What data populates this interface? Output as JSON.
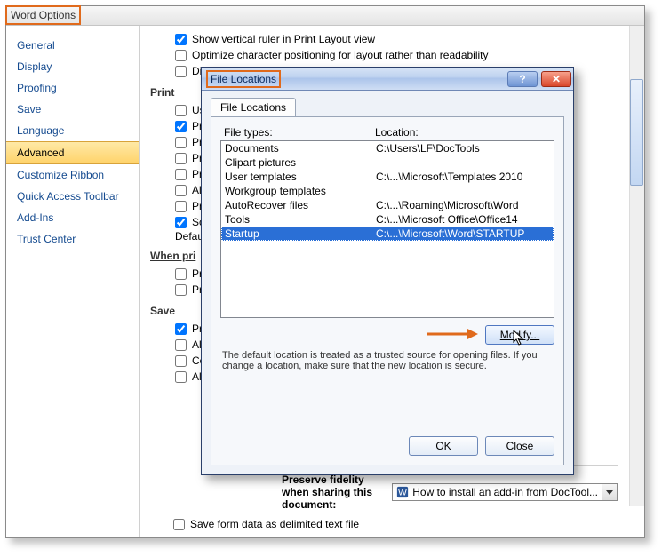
{
  "optionsWindow": {
    "title": "Word Options",
    "sidebar": {
      "items": [
        {
          "label": "General"
        },
        {
          "label": "Display"
        },
        {
          "label": "Proofing"
        },
        {
          "label": "Save"
        },
        {
          "label": "Language"
        },
        {
          "label": "Advanced",
          "active": true
        },
        {
          "label": "Customize Ribbon"
        },
        {
          "label": "Quick Access Toolbar"
        },
        {
          "label": "Add-Ins"
        },
        {
          "label": "Trust Center"
        }
      ]
    },
    "main": {
      "topChecks": [
        {
          "label": "Show vertical ruler in Print Layout view",
          "checked": true
        },
        {
          "label": "Optimize character positioning for layout rather than readability",
          "checked": false
        },
        {
          "label": "Disa",
          "checked": false
        }
      ],
      "printHead": "Print",
      "printChecks": [
        {
          "label": "Use",
          "checked": false
        },
        {
          "label": "Print",
          "checked": true
        },
        {
          "label": "Print",
          "checked": false
        },
        {
          "label": "Print",
          "checked": false
        },
        {
          "label": "Print",
          "checked": false
        },
        {
          "label": "Allow",
          "checked": false
        },
        {
          "label": "Print",
          "checked": false
        },
        {
          "label": "Scal",
          "checked": true
        }
      ],
      "defaultTray": "Default t",
      "whenHead": "When pri",
      "whenChecks": [
        {
          "label": "Print",
          "checked": false
        },
        {
          "label": "Print",
          "checked": false
        }
      ],
      "saveHead": "Save",
      "saveChecks": [
        {
          "label": "Pron",
          "checked": true
        },
        {
          "label": "Alwa",
          "checked": false
        },
        {
          "label": "Cop",
          "checked": false
        },
        {
          "label": "Allow",
          "checked": false
        }
      ],
      "preserve": {
        "label": "Preserve fidelity when sharing this document:",
        "value": "How to install an add-in from DocTool..."
      },
      "bottomCheck": {
        "label": "Save form data as delimited text file",
        "checked": false
      }
    }
  },
  "fileLocations": {
    "title": "File Locations",
    "tab": "File Locations",
    "col1": "File types:",
    "col2": "Location:",
    "rows": [
      {
        "type": "Documents",
        "loc": "C:\\Users\\LF\\DocTools"
      },
      {
        "type": "Clipart pictures",
        "loc": ""
      },
      {
        "type": "User templates",
        "loc": "C:\\...\\Microsoft\\Templates 2010"
      },
      {
        "type": "Workgroup templates",
        "loc": ""
      },
      {
        "type": "AutoRecover files",
        "loc": "C:\\...\\Roaming\\Microsoft\\Word"
      },
      {
        "type": "Tools",
        "loc": "C:\\...\\Microsoft Office\\Office14"
      },
      {
        "type": "Startup",
        "loc": "C:\\...\\Microsoft\\Word\\STARTUP",
        "selected": true
      }
    ],
    "modify": "Modify...",
    "note": "The default location is treated as a trusted source for opening files. If you change a location, make sure that the new location is secure.",
    "ok": "OK",
    "close": "Close",
    "helpGlyph": "?",
    "closeGlyph": "✕"
  }
}
